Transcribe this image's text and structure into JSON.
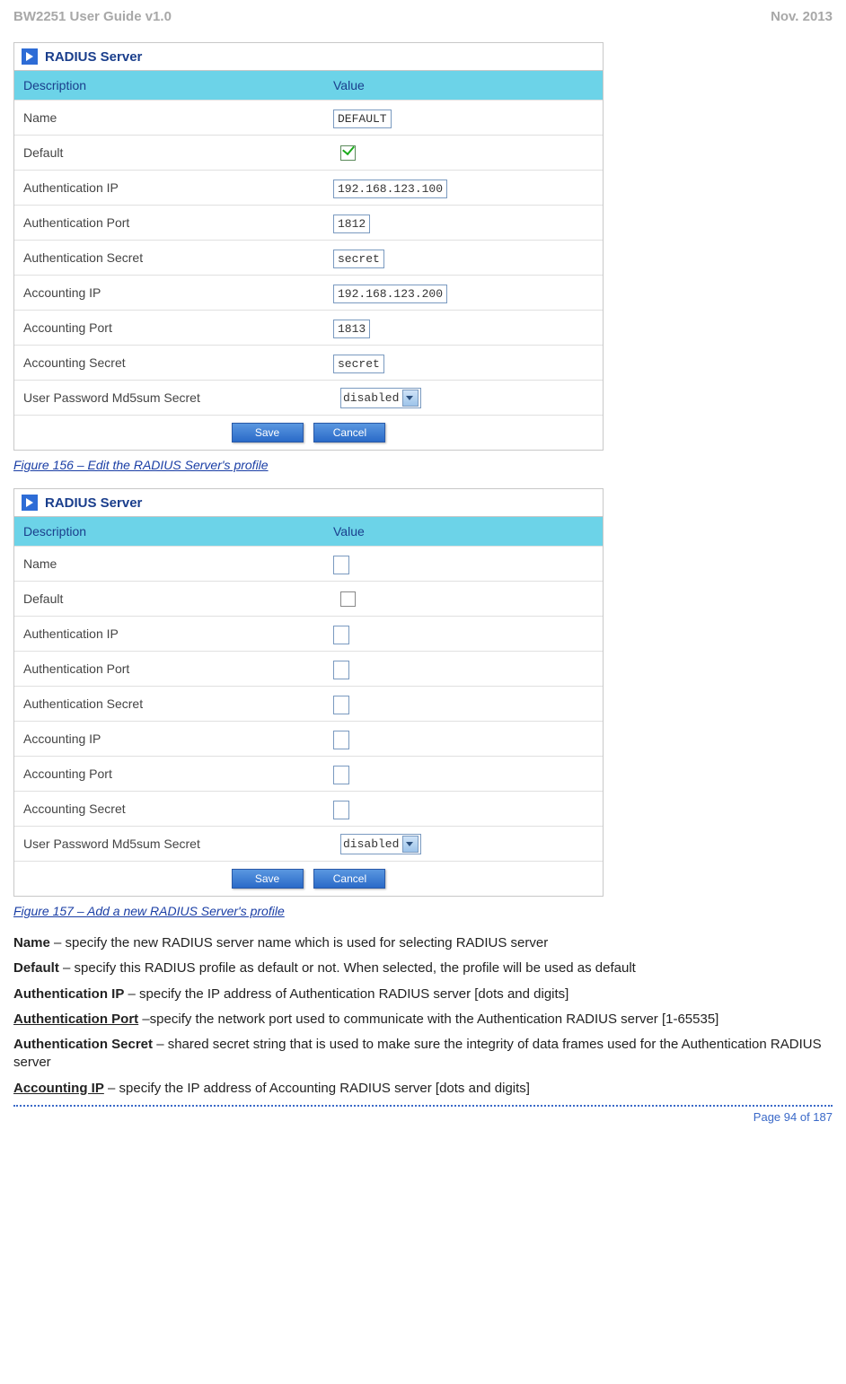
{
  "header": {
    "left": "BW2251 User Guide v1.0",
    "right": "Nov.  2013"
  },
  "panel_title": "RADIUS Server",
  "columns": {
    "a": "Description",
    "b": "Value"
  },
  "rows": [
    {
      "label": "Name",
      "type": "text",
      "cls": "w-name"
    },
    {
      "label": "Default",
      "type": "check"
    },
    {
      "label": "Authentication IP",
      "type": "text",
      "cls": "w-ip"
    },
    {
      "label": "Authentication Port",
      "type": "text",
      "cls": "w-port"
    },
    {
      "label": "Authentication Secret",
      "type": "text",
      "cls": "w-sec"
    },
    {
      "label": "Accounting IP",
      "type": "text",
      "cls": "w-ip"
    },
    {
      "label": "Accounting Port",
      "type": "text",
      "cls": "w-port"
    },
    {
      "label": "Accounting Secret",
      "type": "text",
      "cls": "w-sec"
    },
    {
      "label": "User Password Md5sum Secret",
      "type": "select"
    }
  ],
  "values_edit": {
    "Name": "DEFAULT",
    "Default": true,
    "Authentication IP": "192.168.123.100",
    "Authentication Port": "1812",
    "Authentication Secret": "secret",
    "Accounting IP": "192.168.123.200",
    "Accounting Port": "1813",
    "Accounting Secret": "secret",
    "User Password Md5sum Secret": "disabled"
  },
  "values_add": {
    "Name": "",
    "Default": false,
    "Authentication IP": "",
    "Authentication Port": "",
    "Authentication Secret": "",
    "Accounting IP": "",
    "Accounting Port": "",
    "Accounting Secret": "",
    "User Password Md5sum Secret": "disabled"
  },
  "buttons": {
    "save": "Save",
    "cancel": "Cancel"
  },
  "captions": {
    "fig1": "Figure 156 – Edit the RADIUS Server's profile",
    "fig2": "Figure 157 – Add a new RADIUS Server's profile"
  },
  "defs": [
    {
      "term": "Name",
      "text": " – specify the new RADIUS server name which is used for selecting RADIUS server"
    },
    {
      "term": "Default",
      "text": " – specify this RADIUS profile as default or not. When selected, the profile will be used as default"
    },
    {
      "term": "Authentication IP",
      "text": " – specify the IP address of Authentication RADIUS server [dots and digits]"
    },
    {
      "term": "Authentication Port",
      "u": true,
      "text": " –specify the network port used to communicate with the Authentication RADIUS server [1-65535]"
    },
    {
      "term": "Authentication Secret",
      "text": " – shared secret string that is used to make sure the integrity of data frames used for the Authentication RADIUS server"
    },
    {
      "term": "Accounting IP",
      "u": true,
      "text": " – specify the IP address of Accounting RADIUS server [dots and digits]"
    }
  ],
  "footer": "Page 94 of 187"
}
